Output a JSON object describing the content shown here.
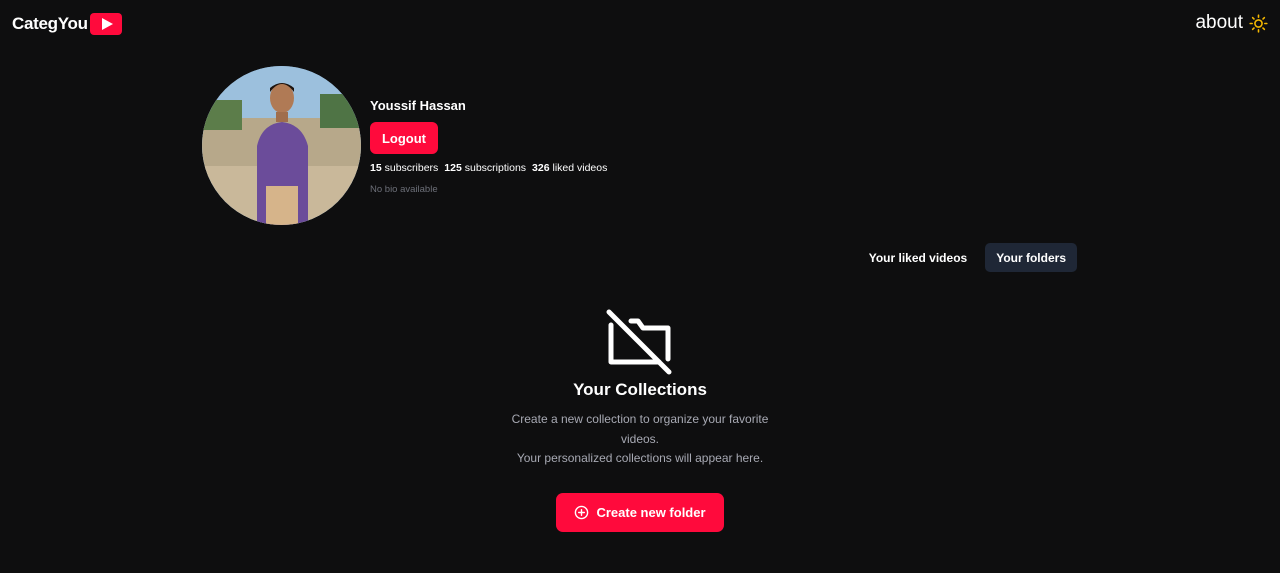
{
  "header": {
    "logo_text": "CategYou",
    "about_label": "about",
    "logo_icon": "play-icon",
    "theme_icon": "sun-icon",
    "accent_color": "#ff0a3c",
    "theme_icon_color": "#f5b800"
  },
  "profile": {
    "name": "Youssif Hassan",
    "logout_label": "Logout",
    "stats": {
      "subscribers_count": "15",
      "subscribers_label": "subscribers",
      "subscriptions_count": "125",
      "subscriptions_label": "subscriptions",
      "liked_count": "326",
      "liked_label": "liked videos"
    },
    "bio": "No bio available"
  },
  "tabs": [
    {
      "label": "Your liked videos",
      "active": false
    },
    {
      "label": "Your folders",
      "active": true
    }
  ],
  "empty_state": {
    "icon": "folder-off-icon",
    "title": "Your Collections",
    "description_line1": "Create a new collection to organize your favorite videos.",
    "description_line2": "Your personalized collections will appear here.",
    "create_label": "Create new folder",
    "create_icon": "plus-circle-icon"
  },
  "colors": {
    "background": "#0e0e0f",
    "active_tab": "#1f2736",
    "muted_text": "#6c6f78"
  }
}
